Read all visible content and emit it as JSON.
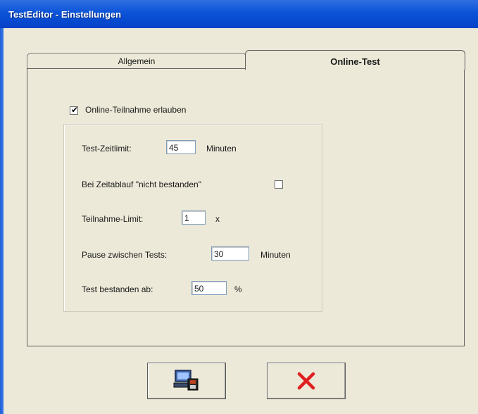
{
  "window": {
    "title": "TestEditor - Einstellungen"
  },
  "tabs": [
    {
      "label": "Allgemein",
      "active": false
    },
    {
      "label": "Online-Test",
      "active": true
    }
  ],
  "online": {
    "allow_label": "Online-Teilnahme erlauben",
    "allow_checked": true,
    "time_limit": {
      "label": "Test-Zeitlimit:",
      "value": "45",
      "unit": "Minuten"
    },
    "timeout_fail": {
      "label": "Bei Zeitablauf \"nicht bestanden\"",
      "checked": false
    },
    "attempt_limit": {
      "label": "Teilnahme-Limit:",
      "value": "1",
      "unit": "x"
    },
    "pause": {
      "label": "Pause zwischen Tests:",
      "value": "30",
      "unit": "Minuten"
    },
    "pass_threshold": {
      "label": "Test bestanden ab:",
      "value": "50",
      "unit": "%"
    }
  },
  "buttons": {
    "save_icon": "save-computer-icon",
    "cancel_icon": "red-x-icon"
  },
  "colors": {
    "titlebar": "#0b53d8",
    "window_bg": "#ece9d8",
    "cancel_red": "#e02020"
  }
}
